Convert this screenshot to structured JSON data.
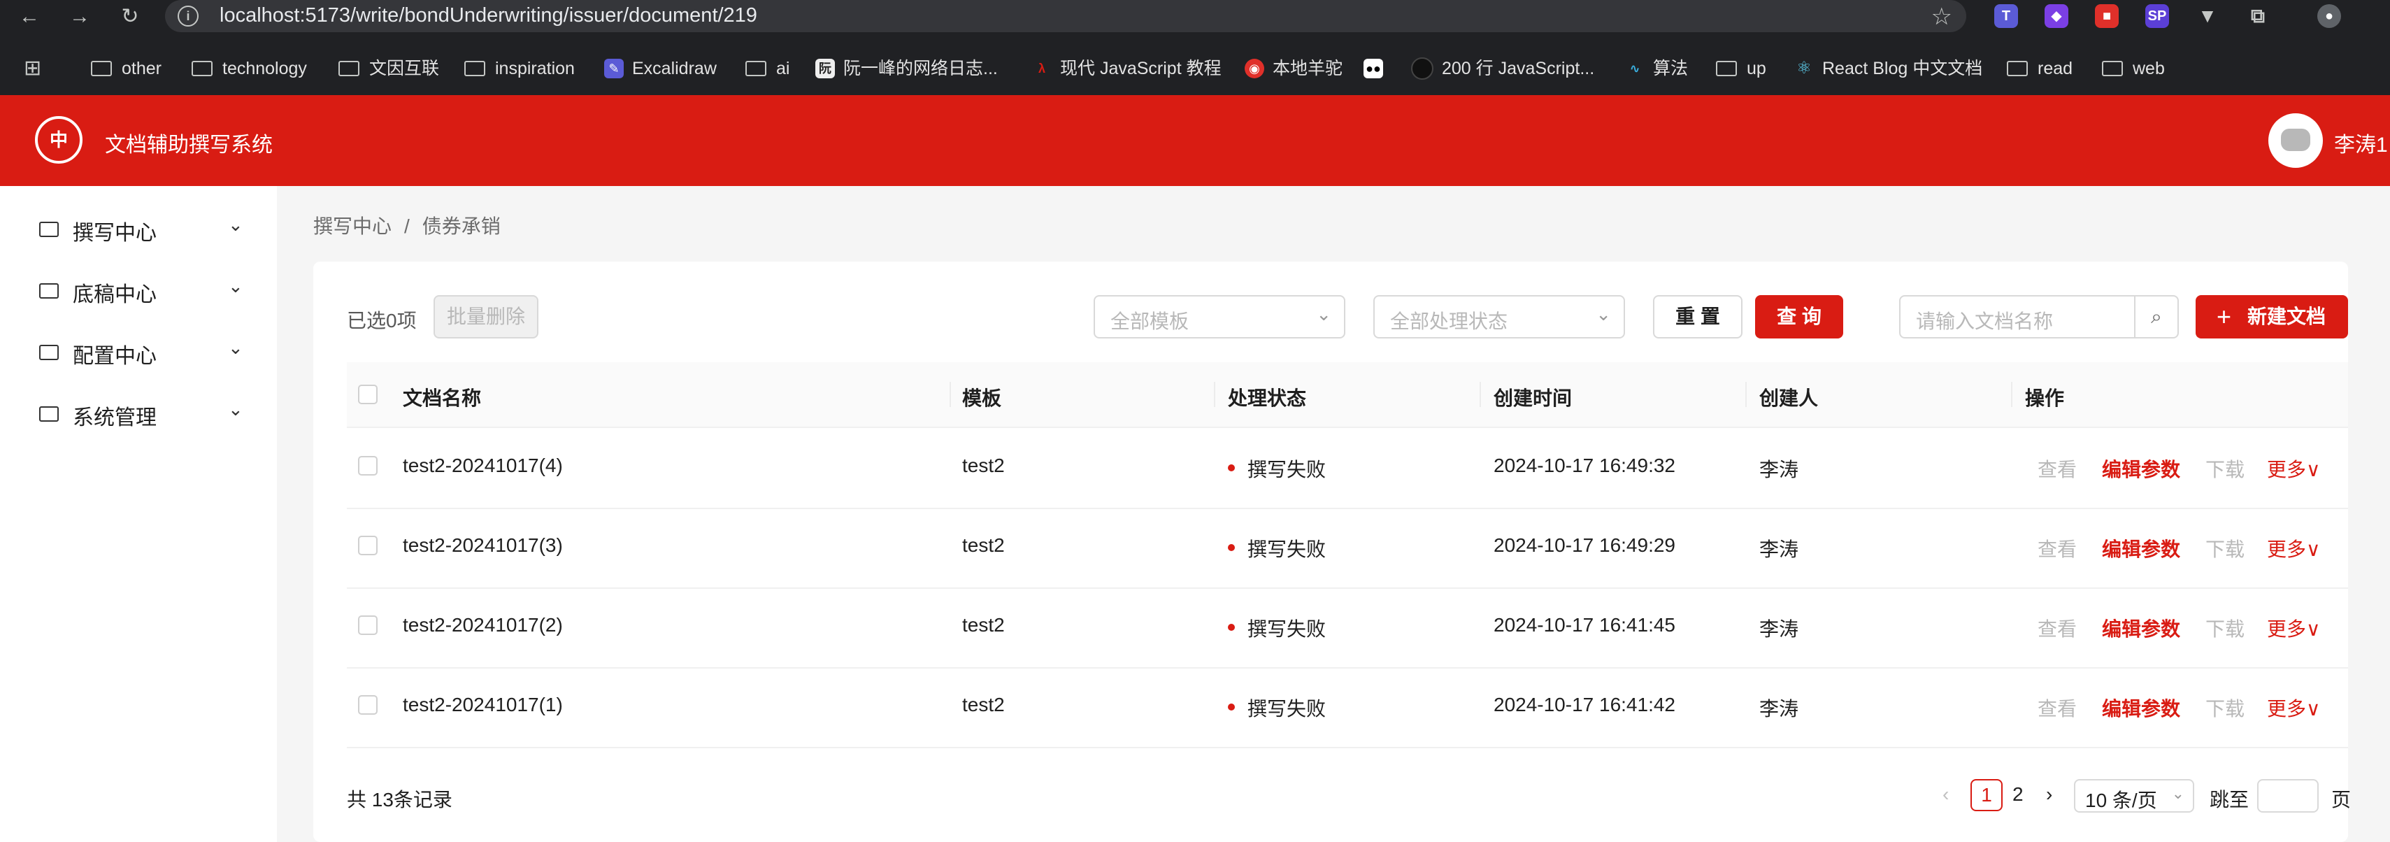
{
  "browser": {
    "url": "localhost:5173/write/bondUnderwriting/issuer/document/219",
    "bookmarks": [
      "other",
      "technology",
      "文因互联",
      "inspiration",
      "Excalidraw",
      "ai",
      "阮一峰的网络日志...",
      "现代 JavaScript 教程",
      "本地羊驼",
      "200 行 JavaScript...",
      "算法",
      "up",
      "React Blog 中文文档",
      "read",
      "web"
    ]
  },
  "app": {
    "title": "文档辅助撰写系统",
    "user": "李涛1",
    "brand_color": "#d91c13"
  },
  "sidebar": {
    "items": [
      {
        "label": "撰写中心"
      },
      {
        "label": "底稿中心"
      },
      {
        "label": "配置中心"
      },
      {
        "label": "系统管理"
      }
    ]
  },
  "breadcrumb": [
    "撰写中心",
    "/",
    "债券承销"
  ],
  "toolbar": {
    "selected": "已选0项",
    "batch_delete": "批量删除",
    "template_placeholder": "全部模板",
    "status_placeholder": "全部处理状态",
    "reset": "重 置",
    "query": "查 询",
    "search_placeholder": "请输入文档名称",
    "new_doc": "新建文档"
  },
  "table": {
    "columns": [
      "文档名称",
      "模板",
      "处理状态",
      "创建时间",
      "创建人",
      "操作"
    ],
    "actions": [
      "查看",
      "编辑参数",
      "下载",
      "更多"
    ],
    "rows": [
      {
        "name": "test2-20241017(4)",
        "template": "test2",
        "status": "撰写失败",
        "created": "2024-10-17 16:49:32",
        "creator": "李涛"
      },
      {
        "name": "test2-20241017(3)",
        "template": "test2",
        "status": "撰写失败",
        "created": "2024-10-17 16:49:29",
        "creator": "李涛"
      },
      {
        "name": "test2-20241017(2)",
        "template": "test2",
        "status": "撰写失败",
        "created": "2024-10-17 16:41:45",
        "creator": "李涛"
      },
      {
        "name": "test2-20241017(1)",
        "template": "test2",
        "status": "撰写失败",
        "created": "2024-10-17 16:41:42",
        "creator": "李涛"
      }
    ]
  },
  "pagination": {
    "total": "共 13条记录",
    "current": "1",
    "next_page": "2",
    "page_size": "10 条/页",
    "jump_label": "跳至",
    "page_label": "页"
  }
}
